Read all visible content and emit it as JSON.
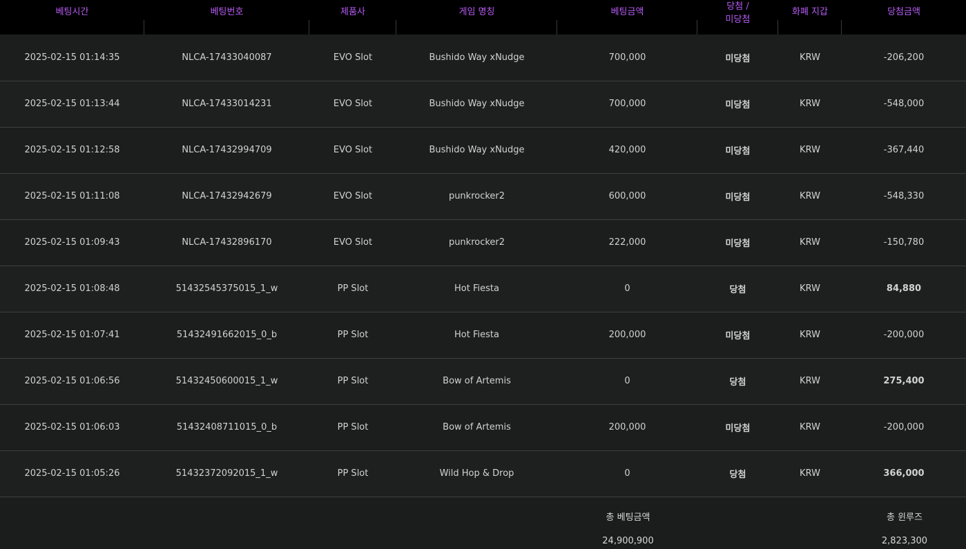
{
  "headers": {
    "bet_time": "베팅시간",
    "bet_number": "베팅번호",
    "provider": "제품사",
    "game_name": "게임 명칭",
    "bet_amount": "베팅금액",
    "result_line1": "당첨 /",
    "result_line2": "미당첨",
    "currency": "화폐 지갑",
    "win_amount": "당첨금액"
  },
  "rows": [
    {
      "time": "2025-02-15 01:14:35",
      "number": "NLCA-17433040087",
      "provider": "EVO Slot",
      "game": "Bushido Way xNudge",
      "bet": "700,000",
      "result": "미당첨",
      "currency": "KRW",
      "win": "-206,200"
    },
    {
      "time": "2025-02-15 01:13:44",
      "number": "NLCA-17433014231",
      "provider": "EVO Slot",
      "game": "Bushido Way xNudge",
      "bet": "700,000",
      "result": "미당첨",
      "currency": "KRW",
      "win": "-548,000"
    },
    {
      "time": "2025-02-15 01:12:58",
      "number": "NLCA-17432994709",
      "provider": "EVO Slot",
      "game": "Bushido Way xNudge",
      "bet": "420,000",
      "result": "미당첨",
      "currency": "KRW",
      "win": "-367,440"
    },
    {
      "time": "2025-02-15 01:11:08",
      "number": "NLCA-17432942679",
      "provider": "EVO Slot",
      "game": "punkrocker2",
      "bet": "600,000",
      "result": "미당첨",
      "currency": "KRW",
      "win": "-548,330"
    },
    {
      "time": "2025-02-15 01:09:43",
      "number": "NLCA-17432896170",
      "provider": "EVO Slot",
      "game": "punkrocker2",
      "bet": "222,000",
      "result": "미당첨",
      "currency": "KRW",
      "win": "-150,780"
    },
    {
      "time": "2025-02-15 01:08:48",
      "number": "51432545375015_1_w",
      "provider": "PP Slot",
      "game": "Hot Fiesta",
      "bet": "0",
      "result": "당첨",
      "currency": "KRW",
      "win": "84,880"
    },
    {
      "time": "2025-02-15 01:07:41",
      "number": "51432491662015_0_b",
      "provider": "PP Slot",
      "game": "Hot Fiesta",
      "bet": "200,000",
      "result": "미당첨",
      "currency": "KRW",
      "win": "-200,000"
    },
    {
      "time": "2025-02-15 01:06:56",
      "number": "51432450600015_1_w",
      "provider": "PP Slot",
      "game": "Bow of Artemis",
      "bet": "0",
      "result": "당첨",
      "currency": "KRW",
      "win": "275,400"
    },
    {
      "time": "2025-02-15 01:06:03",
      "number": "51432408711015_0_b",
      "provider": "PP Slot",
      "game": "Bow of Artemis",
      "bet": "200,000",
      "result": "미당첨",
      "currency": "KRW",
      "win": "-200,000"
    },
    {
      "time": "2025-02-15 01:05:26",
      "number": "51432372092015_1_w",
      "provider": "PP Slot",
      "game": "Wild Hop & Drop",
      "bet": "0",
      "result": "당첨",
      "currency": "KRW",
      "win": "366,000"
    }
  ],
  "summary": {
    "total_bet_label": "총 베팅금액",
    "total_bet_value": "24,900,900",
    "total_win_label": "총 윈루즈",
    "total_win_value": "2,823,300"
  },
  "colors": {
    "header_text": "#b85cf6",
    "lose_text": "#ff4d6a",
    "win_text": "#7ddc58",
    "negative_amount": "#ff3a3a"
  }
}
